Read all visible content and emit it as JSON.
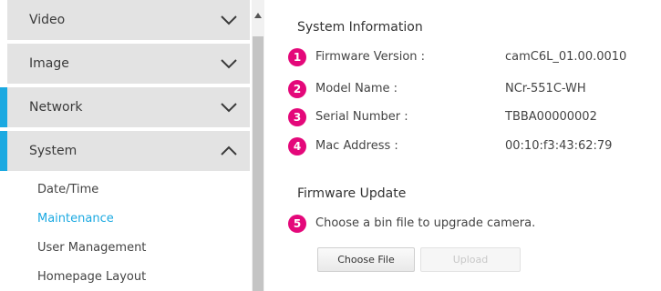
{
  "sidebar": {
    "menus": [
      {
        "label": "Video",
        "expanded": false,
        "active": false
      },
      {
        "label": "Image",
        "expanded": false,
        "active": false
      },
      {
        "label": "Network",
        "expanded": false,
        "active": true
      },
      {
        "label": "System",
        "expanded": true,
        "active": true
      }
    ],
    "sub_items": [
      {
        "label": "Date/Time",
        "active": false
      },
      {
        "label": "Maintenance",
        "active": true
      },
      {
        "label": "User Management",
        "active": false
      },
      {
        "label": "Homepage Layout",
        "active": false
      }
    ]
  },
  "main": {
    "system_info": {
      "title": "System Information",
      "rows": [
        {
          "badge": "1",
          "label": "Firmware Version :",
          "value": "camC6L_01.00.0010"
        },
        {
          "badge": "2",
          "label": "Model Name :",
          "value": "NCr-551C-WH"
        },
        {
          "badge": "3",
          "label": "Serial Number :",
          "value": "TBBA00000002"
        },
        {
          "badge": "4",
          "label": "Mac Address :",
          "value": "00:10:f3:43:62:79"
        }
      ]
    },
    "firmware_update": {
      "title": "Firmware Update",
      "badge": "5",
      "instruction": "Choose a bin file to upgrade camera.",
      "choose_file_label": "Choose File",
      "upload_label": "Upload"
    }
  },
  "colors": {
    "accent": "#1ba9e1",
    "badge": "#e4087a",
    "menu_bg": "#e3e3e3"
  },
  "icons": {
    "menu_collapsed": "chevron-down-icon",
    "menu_expanded": "chevron-up-icon",
    "scroll_up": "triangle-up-icon"
  }
}
